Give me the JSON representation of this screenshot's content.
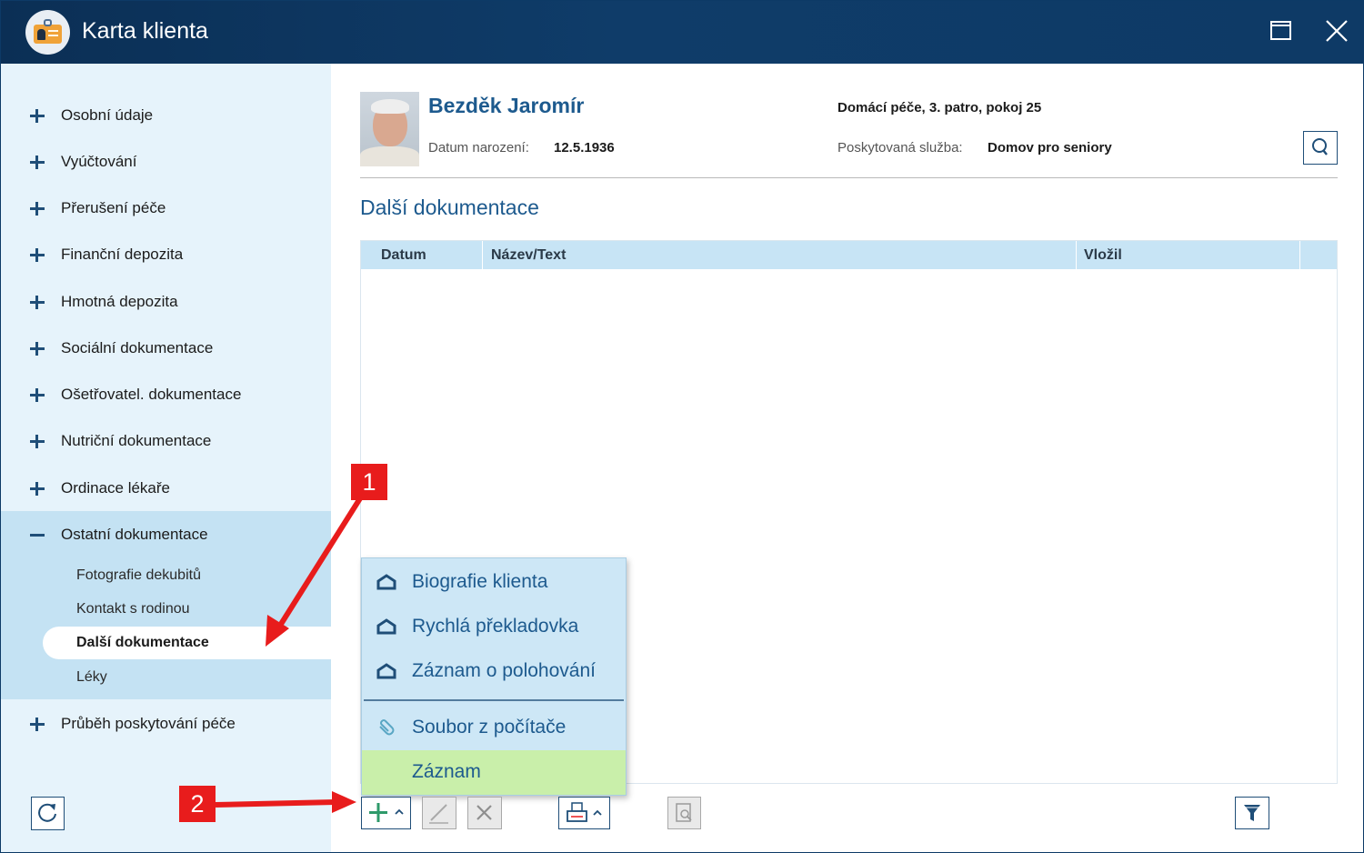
{
  "window": {
    "title": "Karta klienta"
  },
  "sidebar": {
    "items": [
      {
        "label": "Osobní údaje"
      },
      {
        "label": "Vyúčtování"
      },
      {
        "label": "Přerušení péče"
      },
      {
        "label": "Finanční depozita"
      },
      {
        "label": "Hmotná depozita"
      },
      {
        "label": "Sociální dokumentace"
      },
      {
        "label": "Ošetřovatel. dokumentace"
      },
      {
        "label": "Nutriční dokumentace"
      },
      {
        "label": "Ordinace lékaře"
      },
      {
        "label": "Ostatní dokumentace"
      },
      {
        "label": "Průběh poskytování péče"
      }
    ],
    "sub_items": [
      {
        "label": "Fotografie dekubitů"
      },
      {
        "label": "Kontakt s rodinou"
      },
      {
        "label": "Další dokumentace",
        "active": true
      },
      {
        "label": "Léky"
      }
    ]
  },
  "client": {
    "name": "Bezděk Jaromír",
    "dob_label": "Datum narození:",
    "dob_value": "12.5.1936",
    "location": "Domácí péče, 3. patro, pokoj 25",
    "service_label": "Poskytovaná služba:",
    "service_value": "Domov pro seniory"
  },
  "section": {
    "title": "Další dokumentace"
  },
  "table": {
    "columns": [
      "Datum",
      "Název/Text",
      "Vložil"
    ],
    "rows": []
  },
  "add_menu": {
    "items": [
      {
        "label": "Biografie klienta",
        "icon": "form-icon"
      },
      {
        "label": "Rychlá překladovka",
        "icon": "form-icon"
      },
      {
        "label": "Záznam o polohování",
        "icon": "form-icon"
      },
      {
        "label": "Soubor z počítače",
        "icon": "paperclip-icon"
      },
      {
        "label": "Záznam",
        "icon": "",
        "highlighted": true
      }
    ]
  },
  "annotations": {
    "marker1": "1",
    "marker2": "2"
  },
  "colors": {
    "titlebar": "#0f3c69",
    "accent": "#1d5a8e",
    "sidebar": "#e6f3fb",
    "annotation": "#e81c1c",
    "highlight": "#c9efaa"
  }
}
